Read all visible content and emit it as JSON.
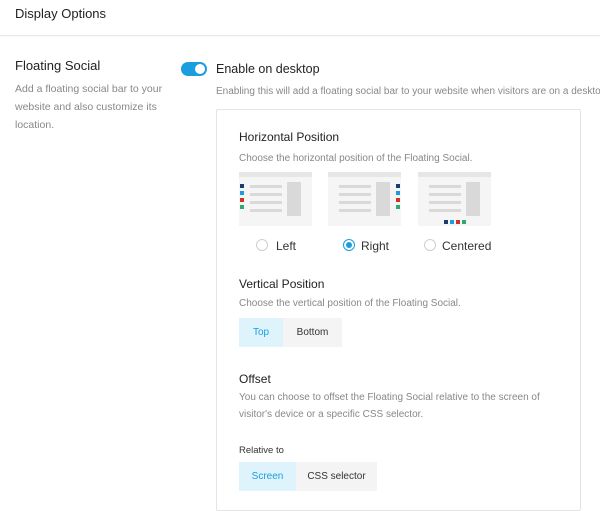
{
  "header": {
    "title": "Display Options"
  },
  "sidebar": {
    "title": "Floating Social",
    "description": "Add a floating social bar to your website and also customize its location."
  },
  "toggle": {
    "label": "Enable on desktop",
    "enabled": true,
    "description": "Enabling this will add a floating social bar to your website when visitors are on a desktop."
  },
  "horizontal": {
    "title": "Horizontal Position",
    "description": "Choose the horizontal position of the Floating Social.",
    "options": [
      {
        "label": "Left",
        "selected": false
      },
      {
        "label": "Right",
        "selected": true
      },
      {
        "label": "Centered",
        "selected": false
      }
    ]
  },
  "vertical": {
    "title": "Vertical Position",
    "description": "Choose the vertical position of the Floating Social.",
    "options": [
      {
        "label": "Top",
        "active": true
      },
      {
        "label": "Bottom",
        "active": false
      }
    ]
  },
  "offset": {
    "title": "Offset",
    "description": "You can choose to offset the Floating Social relative to the screen of visitor's device or a specific CSS selector.",
    "relative_label": "Relative to",
    "options": [
      {
        "label": "Screen",
        "active": true
      },
      {
        "label": "CSS selector",
        "active": false
      }
    ]
  },
  "colors": {
    "accent": "#1b9edd",
    "social": [
      "#1f3a6e",
      "#1b9edd",
      "#d0312d",
      "#2bab6e"
    ]
  }
}
